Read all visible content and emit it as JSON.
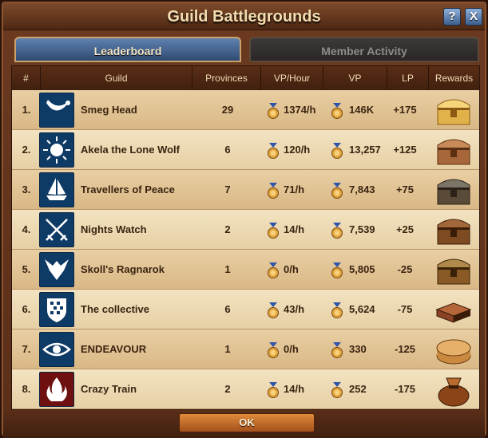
{
  "window": {
    "title": "Guild Battlegrounds",
    "help_label": "?",
    "close_label": "X"
  },
  "tabs": [
    {
      "label": "Leaderboard",
      "active": true
    },
    {
      "label": "Member Activity",
      "active": false
    }
  ],
  "table": {
    "headers": [
      "#",
      "Guild",
      "Provinces",
      "VP/Hour",
      "VP",
      "LP",
      "Rewards"
    ],
    "rows": [
      {
        "rank": "1.",
        "guild": "Smeg Head",
        "provinces": "29",
        "vp_hour": "1374/h",
        "vp": "146K",
        "lp": "+175",
        "emblem": "horn-emblem-icon",
        "reward": "golden-chest-icon"
      },
      {
        "rank": "2.",
        "guild": "Akela the Lone Wolf",
        "provinces": "6",
        "vp_hour": "120/h",
        "vp": "13,257",
        "lp": "+125",
        "emblem": "sun-emblem-icon",
        "reward": "ornate-chest-icon"
      },
      {
        "rank": "3.",
        "guild": "Travellers of Peace",
        "provinces": "7",
        "vp_hour": "71/h",
        "vp": "7,843",
        "lp": "+75",
        "emblem": "ship-emblem-icon",
        "reward": "steel-chest-icon"
      },
      {
        "rank": "4.",
        "guild": "Nights Watch",
        "provinces": "2",
        "vp_hour": "14/h",
        "vp": "7,539",
        "lp": "+25",
        "emblem": "crossed-swords-emblem-icon",
        "reward": "wooden-chest-icon"
      },
      {
        "rank": "5.",
        "guild": "Skoll's Ragnarok",
        "provinces": "1",
        "vp_hour": "0/h",
        "vp": "5,805",
        "lp": "-25",
        "emblem": "eagle-emblem-icon",
        "reward": "small-chest-icon"
      },
      {
        "rank": "6.",
        "guild": "The collective",
        "provinces": "6",
        "vp_hour": "43/h",
        "vp": "5,624",
        "lp": "-75",
        "emblem": "shield-emblem-icon",
        "reward": "box-icon"
      },
      {
        "rank": "7.",
        "guild": "ENDEAVOUR",
        "provinces": "1",
        "vp_hour": "0/h",
        "vp": "330",
        "lp": "-125",
        "emblem": "eye-emblem-icon",
        "reward": "round-box-icon"
      },
      {
        "rank": "8.",
        "guild": "Crazy Train",
        "provinces": "2",
        "vp_hour": "14/h",
        "vp": "252",
        "lp": "-175",
        "emblem": "flame-emblem-icon",
        "reward": "sack-icon"
      }
    ]
  },
  "footer": {
    "ok_label": "OK"
  },
  "colors": {
    "frame": "#5a2e18",
    "header": "#40200f",
    "row_light": "#f3e3c1",
    "row_dark": "#e9cfa4",
    "emblem_blue": "#0e3a66",
    "emblem_red": "#6e1010",
    "tab_active": "#3d5f8f"
  }
}
